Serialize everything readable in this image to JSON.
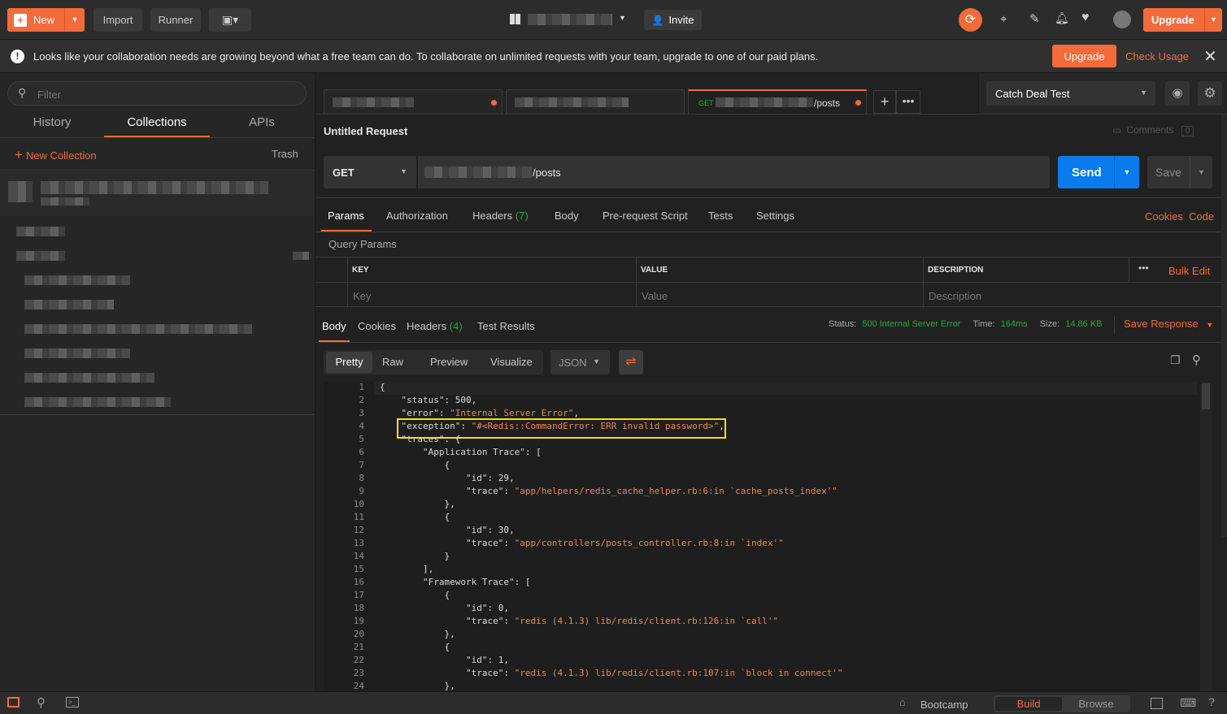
{
  "topbar": {
    "new_label": "New",
    "import_label": "Import",
    "runner_label": "Runner",
    "invite_label": "Invite",
    "upgrade_label": "Upgrade"
  },
  "banner": {
    "message": "Looks like your collaboration needs are growing beyond what a free team can do. To collaborate on unlimited requests with your team, upgrade to one of our paid plans.",
    "upgrade_label": "Upgrade",
    "check_usage_label": "Check Usage"
  },
  "sidebar": {
    "filter_placeholder": "Filter",
    "tabs": [
      "History",
      "Collections",
      "APIs"
    ],
    "active_tab": "Collections",
    "new_collection_label": "New Collection",
    "trash_label": "Trash"
  },
  "tabs": {
    "tab3_method": "GET",
    "tab3_path": "/posts"
  },
  "env": {
    "selected": "Catch Deal Test"
  },
  "request": {
    "title": "Untitled Request",
    "comments_label": "Comments",
    "comments_count": "0",
    "method": "GET",
    "url_path": "/posts",
    "send_label": "Send",
    "save_label": "Save"
  },
  "request_tabs": {
    "params": "Params",
    "authorization": "Authorization",
    "headers": "Headers",
    "headers_count": "(7)",
    "body": "Body",
    "prerequest": "Pre-request Script",
    "tests": "Tests",
    "settings": "Settings",
    "cookies": "Cookies",
    "code": "Code"
  },
  "params": {
    "title": "Query Params",
    "col_key": "KEY",
    "col_value": "VALUE",
    "col_desc": "DESCRIPTION",
    "bulk_edit": "Bulk Edit",
    "key_placeholder": "Key",
    "value_placeholder": "Value",
    "desc_placeholder": "Description"
  },
  "response": {
    "tabs": {
      "body": "Body",
      "cookies": "Cookies",
      "headers": "Headers",
      "headers_count": "(4)",
      "test_results": "Test Results"
    },
    "status_label": "Status:",
    "status_value": "500 Internal Server Error",
    "time_label": "Time:",
    "time_value": "164ms",
    "size_label": "Size:",
    "size_value": "14.86 KB",
    "save_response": "Save Response"
  },
  "viewer": {
    "modes": [
      "Pretty",
      "Raw",
      "Preview",
      "Visualize"
    ],
    "format": "JSON"
  },
  "code_lines": [
    {
      "n": "1",
      "t": "{"
    },
    {
      "n": "2",
      "t": "    \"status\": 500,"
    },
    {
      "n": "3",
      "t": "    \"error\": \"Internal Server Error\","
    },
    {
      "n": "4",
      "t": "    \"exception\": \"#<Redis::CommandError: ERR invalid password>\","
    },
    {
      "n": "5",
      "t": "    \"traces\": {"
    },
    {
      "n": "6",
      "t": "        \"Application Trace\": ["
    },
    {
      "n": "7",
      "t": "            {"
    },
    {
      "n": "8",
      "t": "                \"id\": 29,"
    },
    {
      "n": "9",
      "t": "                \"trace\": \"app/helpers/redis_cache_helper.rb:6:in `cache_posts_index'\""
    },
    {
      "n": "10",
      "t": "            },"
    },
    {
      "n": "11",
      "t": "            {"
    },
    {
      "n": "12",
      "t": "                \"id\": 30,"
    },
    {
      "n": "13",
      "t": "                \"trace\": \"app/controllers/posts_controller.rb:8:in `index'\""
    },
    {
      "n": "14",
      "t": "            }"
    },
    {
      "n": "15",
      "t": "        ],"
    },
    {
      "n": "16",
      "t": "        \"Framework Trace\": ["
    },
    {
      "n": "17",
      "t": "            {"
    },
    {
      "n": "18",
      "t": "                \"id\": 0,"
    },
    {
      "n": "19",
      "t": "                \"trace\": \"redis (4.1.3) lib/redis/client.rb:126:in `call'\""
    },
    {
      "n": "20",
      "t": "            },"
    },
    {
      "n": "21",
      "t": "            {"
    },
    {
      "n": "22",
      "t": "                \"id\": 1,"
    },
    {
      "n": "23",
      "t": "                \"trace\": \"redis (4.1.3) lib/redis/client.rb:107:in `block in connect'\""
    },
    {
      "n": "24",
      "t": "            },"
    }
  ],
  "statusbar": {
    "bootcamp": "Bootcamp",
    "build": "Build",
    "browse": "Browse"
  },
  "colors": {
    "accent": "#f26b3a",
    "send": "#097bed",
    "success": "#28a745",
    "highlight": "#f0e020"
  }
}
